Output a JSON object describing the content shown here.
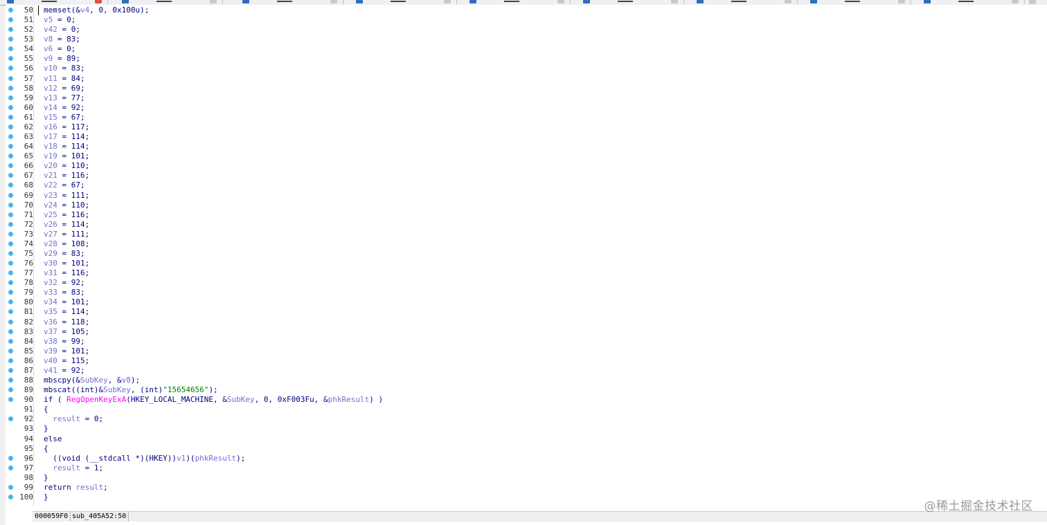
{
  "editor": {
    "lines": [
      {
        "num": "50",
        "dot": true,
        "html": "memset(&amp;<span class=\"var\">v4</span>, 0, 0x100u);"
      },
      {
        "num": "51",
        "dot": true,
        "html": "<span class=\"var\">v5</span> = 0;"
      },
      {
        "num": "52",
        "dot": true,
        "html": "<span class=\"var\">v42</span> = 0;"
      },
      {
        "num": "53",
        "dot": true,
        "html": "<span class=\"var\">v8</span> = 83;"
      },
      {
        "num": "54",
        "dot": true,
        "html": "<span class=\"var\">v6</span> = 0;"
      },
      {
        "num": "55",
        "dot": true,
        "html": "<span class=\"var\">v9</span> = 89;"
      },
      {
        "num": "56",
        "dot": true,
        "html": "<span class=\"var\">v10</span> = 83;"
      },
      {
        "num": "57",
        "dot": true,
        "html": "<span class=\"var\">v11</span> = 84;"
      },
      {
        "num": "58",
        "dot": true,
        "html": "<span class=\"var\">v12</span> = 69;"
      },
      {
        "num": "59",
        "dot": true,
        "html": "<span class=\"var\">v13</span> = 77;"
      },
      {
        "num": "60",
        "dot": true,
        "html": "<span class=\"var\">v14</span> = 92;"
      },
      {
        "num": "61",
        "dot": true,
        "html": "<span class=\"var\">v15</span> = 67;"
      },
      {
        "num": "62",
        "dot": true,
        "html": "<span class=\"var\">v16</span> = 117;"
      },
      {
        "num": "63",
        "dot": true,
        "html": "<span class=\"var\">v17</span> = 114;"
      },
      {
        "num": "64",
        "dot": true,
        "html": "<span class=\"var\">v18</span> = 114;"
      },
      {
        "num": "65",
        "dot": true,
        "html": "<span class=\"var\">v19</span> = 101;"
      },
      {
        "num": "66",
        "dot": true,
        "html": "<span class=\"var\">v20</span> = 110;"
      },
      {
        "num": "67",
        "dot": true,
        "html": "<span class=\"var\">v21</span> = 116;"
      },
      {
        "num": "68",
        "dot": true,
        "html": "<span class=\"var\">v22</span> = 67;"
      },
      {
        "num": "69",
        "dot": true,
        "html": "<span class=\"var\">v23</span> = 111;"
      },
      {
        "num": "70",
        "dot": true,
        "html": "<span class=\"var\">v24</span> = 110;"
      },
      {
        "num": "71",
        "dot": true,
        "html": "<span class=\"var\">v25</span> = 116;"
      },
      {
        "num": "72",
        "dot": true,
        "html": "<span class=\"var\">v26</span> = 114;"
      },
      {
        "num": "73",
        "dot": true,
        "html": "<span class=\"var\">v27</span> = 111;"
      },
      {
        "num": "74",
        "dot": true,
        "html": "<span class=\"var\">v28</span> = 108;"
      },
      {
        "num": "75",
        "dot": true,
        "html": "<span class=\"var\">v29</span> = 83;"
      },
      {
        "num": "76",
        "dot": true,
        "html": "<span class=\"var\">v30</span> = 101;"
      },
      {
        "num": "77",
        "dot": true,
        "html": "<span class=\"var\">v31</span> = 116;"
      },
      {
        "num": "78",
        "dot": true,
        "html": "<span class=\"var\">v32</span> = 92;"
      },
      {
        "num": "79",
        "dot": true,
        "html": "<span class=\"var\">v33</span> = 83;"
      },
      {
        "num": "80",
        "dot": true,
        "html": "<span class=\"var\">v34</span> = 101;"
      },
      {
        "num": "81",
        "dot": true,
        "html": "<span class=\"var\">v35</span> = 114;"
      },
      {
        "num": "82",
        "dot": true,
        "html": "<span class=\"var\">v36</span> = 118;"
      },
      {
        "num": "83",
        "dot": true,
        "html": "<span class=\"var\">v37</span> = 105;"
      },
      {
        "num": "84",
        "dot": true,
        "html": "<span class=\"var\">v38</span> = 99;"
      },
      {
        "num": "85",
        "dot": true,
        "html": "<span class=\"var\">v39</span> = 101;"
      },
      {
        "num": "86",
        "dot": true,
        "html": "<span class=\"var\">v40</span> = 115;"
      },
      {
        "num": "87",
        "dot": true,
        "html": "<span class=\"var\">v41</span> = 92;"
      },
      {
        "num": "88",
        "dot": true,
        "html": "mbscpy(&amp;<span class=\"var\">SubKey</span>, &amp;<span class=\"var\">v8</span>);"
      },
      {
        "num": "89",
        "dot": true,
        "html": "mbscat((int)&amp;<span class=\"var\">SubKey</span>, (int)<span class=\"str\">\"15654656\"</span>);"
      },
      {
        "num": "90",
        "dot": true,
        "html": "if ( <span class=\"call\">RegOpenKeyExA</span>(HKEY_LOCAL_MACHINE, &amp;<span class=\"var\">SubKey</span>, 0, 0xF003Fu, &amp;<span class=\"var\">phkResult</span>) )"
      },
      {
        "num": "91",
        "dot": false,
        "html": "{"
      },
      {
        "num": "92",
        "dot": true,
        "html": "  <span class=\"var\">result</span> = 0;"
      },
      {
        "num": "93",
        "dot": false,
        "html": "}"
      },
      {
        "num": "94",
        "dot": false,
        "html": "else"
      },
      {
        "num": "95",
        "dot": false,
        "html": "{"
      },
      {
        "num": "96",
        "dot": true,
        "html": "  ((void (__stdcall *)(HKEY))<span class=\"var\">v1</span>)(<span class=\"var\">phkResult</span>);"
      },
      {
        "num": "97",
        "dot": true,
        "html": "  <span class=\"var\">result</span> = 1;"
      },
      {
        "num": "98",
        "dot": false,
        "html": "}"
      },
      {
        "num": "99",
        "dot": true,
        "html": "return <span class=\"var\">result</span>;"
      },
      {
        "num": "100",
        "dot": true,
        "html": "}"
      }
    ]
  },
  "status": {
    "address": "000059F0",
    "location": "sub_405A52:50"
  },
  "watermark": "@稀土掘金技术社区",
  "colors": {
    "keyword": "#000080",
    "variable": "#7070d0",
    "string": "#008000",
    "api_call": "#ff00ff",
    "breakpoint_dot": "#48b4f0"
  }
}
